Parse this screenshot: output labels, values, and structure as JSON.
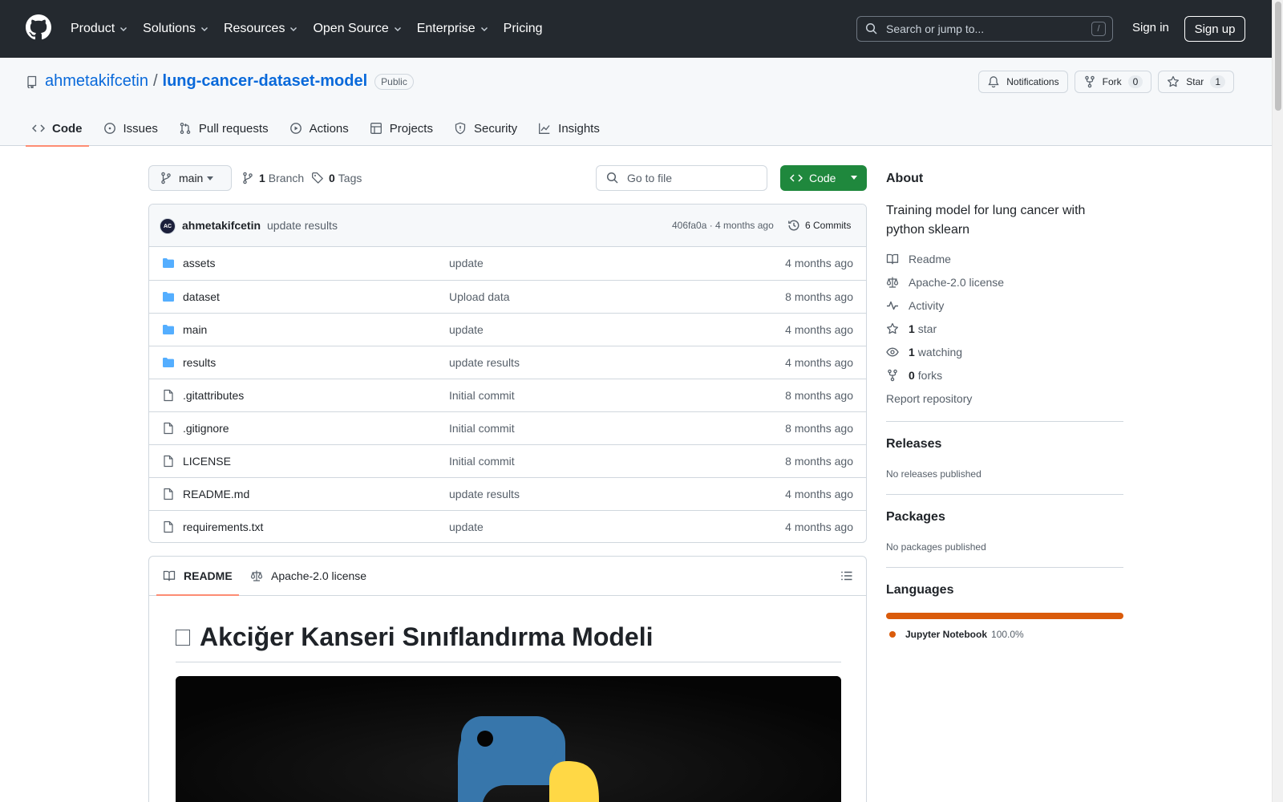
{
  "header": {
    "nav": [
      "Product",
      "Solutions",
      "Resources",
      "Open Source",
      "Enterprise",
      "Pricing"
    ],
    "search_placeholder": "Search or jump to...",
    "search_shortcut": "/",
    "sign_in": "Sign in",
    "sign_up": "Sign up"
  },
  "repo": {
    "owner": "ahmetakifcetin",
    "separator": "/",
    "name": "lung-cancer-dataset-model",
    "visibility": "Public",
    "notifications": "Notifications",
    "fork_label": "Fork",
    "fork_count": "0",
    "star_label": "Star",
    "star_count": "1",
    "tabs": [
      "Code",
      "Issues",
      "Pull requests",
      "Actions",
      "Projects",
      "Security",
      "Insights"
    ]
  },
  "toolbar": {
    "branch": "main",
    "branch_count": "1",
    "branch_label": "Branch",
    "tag_count": "0",
    "tag_label": "Tags",
    "goto_placeholder": "Go to file",
    "code_button": "Code"
  },
  "commit": {
    "avatar_initials": "AC",
    "author": "ahmetakifcetin",
    "message": "update results",
    "meta": "406fa0a · 4 months ago",
    "count_label": "6 Commits"
  },
  "files": [
    {
      "name": "assets",
      "type": "dir",
      "message": "update",
      "date": "4 months ago"
    },
    {
      "name": "dataset",
      "type": "dir",
      "message": "Upload data",
      "date": "8 months ago"
    },
    {
      "name": "main",
      "type": "dir",
      "message": "update",
      "date": "4 months ago"
    },
    {
      "name": "results",
      "type": "dir",
      "message": "update results",
      "date": "4 months ago"
    },
    {
      "name": ".gitattributes",
      "type": "file",
      "message": "Initial commit",
      "date": "8 months ago"
    },
    {
      "name": ".gitignore",
      "type": "file",
      "message": "Initial commit",
      "date": "8 months ago"
    },
    {
      "name": "LICENSE",
      "type": "file",
      "message": "Initial commit",
      "date": "8 months ago"
    },
    {
      "name": "README.md",
      "type": "file",
      "message": "update results",
      "date": "4 months ago"
    },
    {
      "name": "requirements.txt",
      "type": "file",
      "message": "update",
      "date": "4 months ago"
    }
  ],
  "readme": {
    "tab_readme": "README",
    "tab_license": "Apache-2.0 license",
    "heading": "Akciğer Kanseri Sınıflandırma Modeli"
  },
  "sidebar": {
    "about_title": "About",
    "description": "Training model for lung cancer with python sklearn",
    "readme": "Readme",
    "license": "Apache-2.0 license",
    "activity": "Activity",
    "stars_count": "1",
    "stars_label": "star",
    "watching_count": "1",
    "watching_label": "watching",
    "forks_count": "0",
    "forks_label": "forks",
    "report": "Report repository",
    "releases_title": "Releases",
    "releases_note": "No releases published",
    "packages_title": "Packages",
    "packages_note": "No packages published",
    "languages_title": "Languages",
    "language_name": "Jupyter Notebook",
    "language_pct": "100.0%",
    "language_color": "#da5b0b"
  },
  "colors": {
    "header_bg": "#24292f",
    "link": "#0969da",
    "code_button": "#1f883d",
    "tab_underline": "#fd8c73",
    "folder": "#54aeff"
  }
}
